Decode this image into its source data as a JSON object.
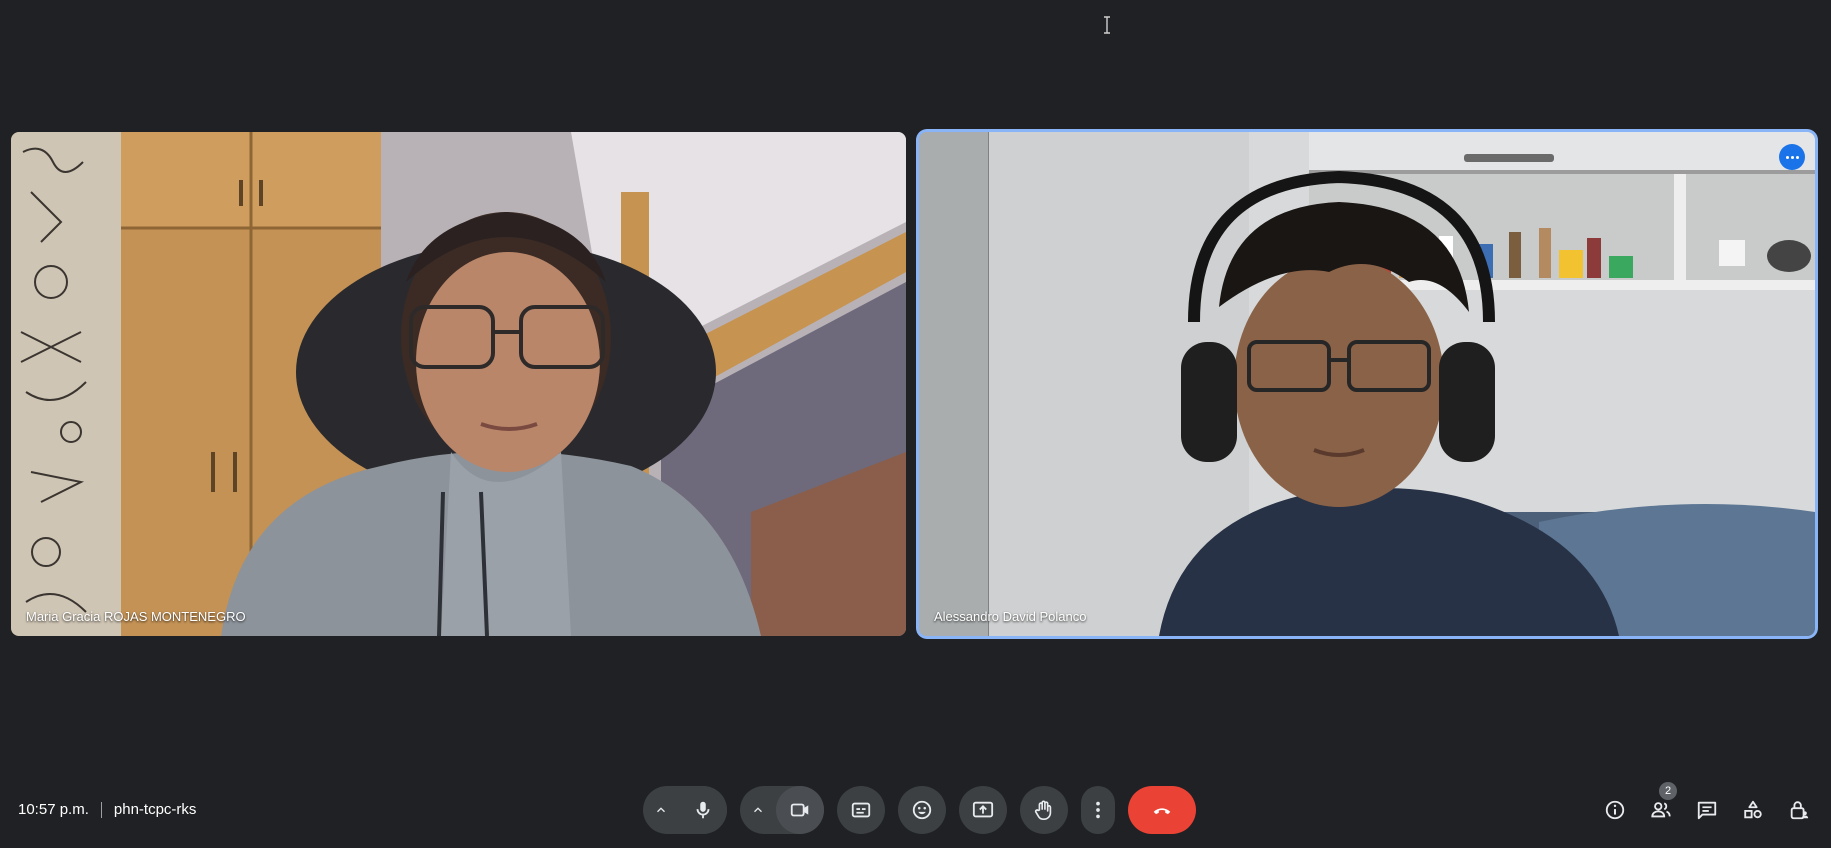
{
  "participants": [
    {
      "name": "Maria Gracia ROJAS MONTENEGRO"
    },
    {
      "name": "Alessandro David Polanco"
    }
  ],
  "meeting": {
    "time": "10:57 p.m.",
    "code": "phn-tcpc-rks"
  },
  "controls": {
    "mic_icon": "microphone-icon",
    "camera_icon": "videocam-icon",
    "captions_icon": "closed-captions-icon",
    "reactions_icon": "emoji-icon",
    "present_icon": "present-screen-icon",
    "raise_hand_icon": "raise-hand-icon",
    "more_icon": "more-vert-icon",
    "end_call_icon": "call-end-icon"
  },
  "side_panel": {
    "people_count": "2"
  },
  "colors": {
    "background": "#202124",
    "button": "#3c4043",
    "end_call": "#ea4335",
    "active_speaker": "#8ab4f8",
    "accent": "#1a73e8"
  }
}
